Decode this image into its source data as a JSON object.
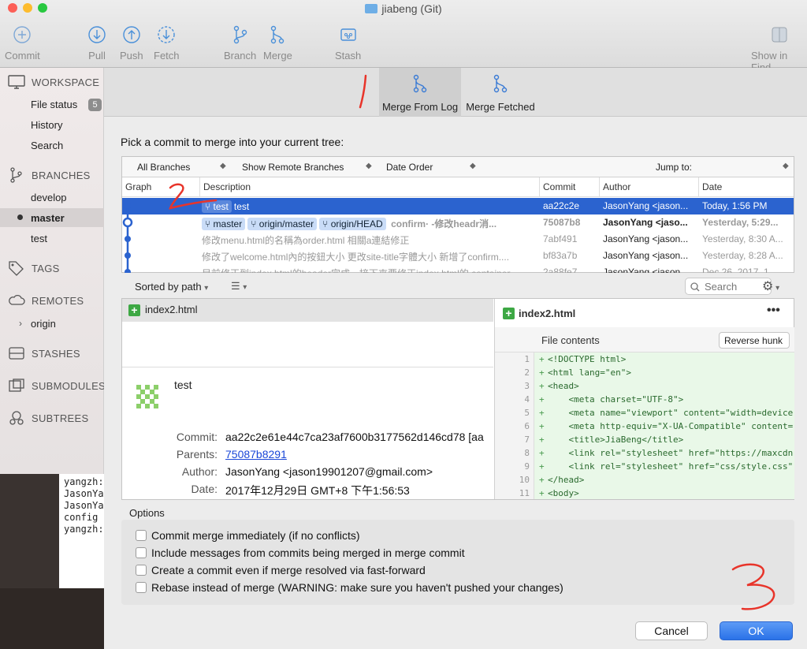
{
  "window": {
    "title": "jiabeng (Git)"
  },
  "toolbar": {
    "commit": "Commit",
    "pull": "Pull",
    "push": "Push",
    "fetch": "Fetch",
    "branch": "Branch",
    "merge": "Merge",
    "stash": "Stash",
    "show_in_finder": "Show in Find"
  },
  "sidebar": {
    "workspace": "WORKSPACE",
    "file_status": "File status",
    "file_status_count": "5",
    "history": "History",
    "search": "Search",
    "branches": "BRANCHES",
    "branch_items": [
      "develop",
      "master",
      "test"
    ],
    "tags": "TAGS",
    "remotes": "REMOTES",
    "remote_items": [
      "origin"
    ],
    "stashes": "STASHES",
    "submodules": "SUBMODULES",
    "subtrees": "SUBTREES"
  },
  "terminal": {
    "lines": [
      "yangzh:",
      "JasonYa",
      "JasonYa",
      "config",
      "yangzh:"
    ]
  },
  "sheet": {
    "tabs": [
      "Merge From Log",
      "Merge Fetched"
    ],
    "prompt": "Pick a commit to merge into your current tree:",
    "filters": {
      "branches": "All Branches",
      "remote": "Show Remote Branches",
      "order": "Date Order",
      "jump": "Jump to:"
    },
    "columns": [
      "Graph",
      "Description",
      "Commit",
      "Author",
      "Date"
    ],
    "commits": [
      {
        "tags": [
          "test"
        ],
        "message": "test",
        "hash": "aa22c2e",
        "author": "JasonYang <jason...",
        "date": "Today, 1:56 PM"
      },
      {
        "tags": [
          "master",
          "origin/master",
          "origin/HEAD"
        ],
        "message": "confirm· -修改headr消...",
        "hash": "75087b8",
        "author": "JasonYang <jaso...",
        "date": "Yesterday, 5:29..."
      },
      {
        "tags": [],
        "message": "修改menu.html的名稱為order.html 相關a連結修正",
        "hash": "7abf491",
        "author": "JasonYang <jason...",
        "date": "Yesterday, 8:30 A..."
      },
      {
        "tags": [],
        "message": "修改了welcome.html內的按鈕大小 更改site-title字體大小 新增了confirm....",
        "hash": "bf83a7b",
        "author": "JasonYang <jason...",
        "date": "Yesterday, 8:28 A..."
      },
      {
        "tags": [],
        "message": "目前修正到index.html的header完成，接下來要修正index.html的.container",
        "hash": "2a88fe7",
        "author": "JasonYang <jason...",
        "date": "Dec 26, 2017, 1..."
      }
    ],
    "diff_sort": "Sorted by path",
    "search_placeholder": "Search",
    "file": "index2.html",
    "commit_info": {
      "subject": "test",
      "commit_label": "Commit:",
      "commit_value": "aa22c2e61e44c7ca23af7600b3177562d146cd78 [aa",
      "parents_label": "Parents:",
      "parents_value": "75087b8291",
      "author_label": "Author:",
      "author_value": "JasonYang <jason19901207@gmail.com>",
      "date_label": "Date:",
      "date_value": "2017年12月29日 GMT+8 下午1:56:53"
    },
    "right_pane": {
      "filename": "index2.html",
      "file_contents": "File contents",
      "reverse_hunk": "Reverse hunk",
      "lines": [
        "<!DOCTYPE html>",
        "<html lang=\"en\">",
        "<head>",
        "    <meta charset=\"UTF-8\">",
        "    <meta name=\"viewport\" content=\"width=device",
        "    <meta http-equiv=\"X-UA-Compatible\" content=",
        "    <title>JiaBeng</title>",
        "    <link rel=\"stylesheet\" href=\"https://maxcdn",
        "    <link rel=\"stylesheet\" href=\"css/style.css\"",
        "</head>",
        "<body>"
      ]
    },
    "options_label": "Options",
    "options": [
      "Commit merge immediately (if no conflicts)",
      "Include messages from commits being merged in merge commit",
      "Create a commit even if merge resolved via fast-forward",
      "Rebase instead of merge (WARNING: make sure you haven't pushed your changes)"
    ],
    "cancel": "Cancel",
    "ok": "OK"
  },
  "colors": {
    "selection": "#2b63cf",
    "accent": "#2a72e8",
    "annotation": "#e8342a",
    "added": "#3da844"
  }
}
